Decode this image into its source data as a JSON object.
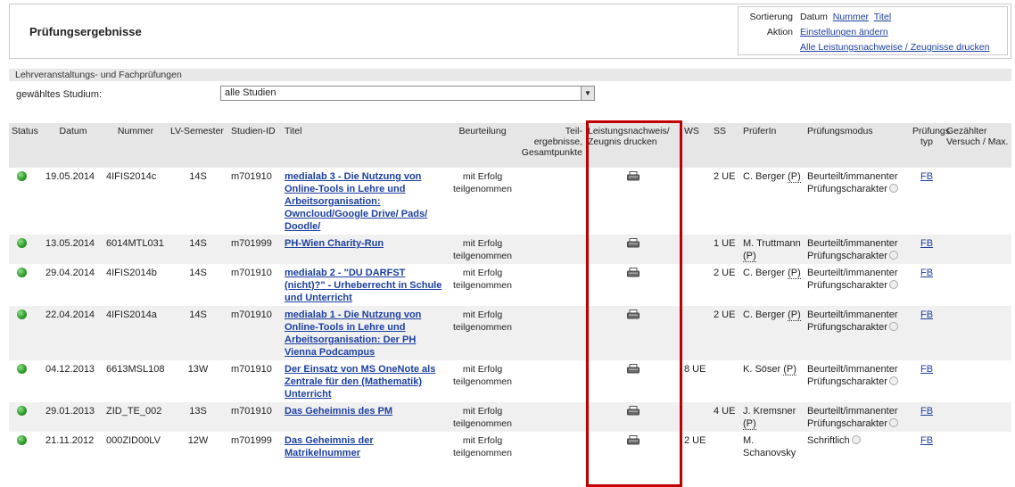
{
  "page": {
    "title": "Prüfungsergebnisse"
  },
  "sort_box": {
    "sort_label": "Sortierung",
    "sort_current": "Datum",
    "sort_number": "Nummer",
    "sort_title": "Titel",
    "action_label": "Aktion",
    "action_settings": "Einstellungen ändern",
    "action_print_all": "Alle Leistungsnachweise / Zeugnisse drucken"
  },
  "section": {
    "heading": "Lehrveranstaltungs- und Fachprüfungen",
    "studium_label": "gewähltes Studium:",
    "studium_value": "alle Studien"
  },
  "table": {
    "headers": {
      "status": "Status",
      "datum": "Datum",
      "nummer": "Nummer",
      "lv_semester": "LV-Semester",
      "studien_id": "Studien-ID",
      "titel": "Titel",
      "beurteilung": "Beurteilung",
      "teil": "Teil-ergebnisse, Gesamtpunkte",
      "leistung": "Leistungsnachweis/ Zeugnis drucken",
      "ws": "WS",
      "ss": "SS",
      "pruefer": "PrüferIn",
      "modus": "Prüfungsmodus",
      "typ": "Prüfungs typ",
      "versuch": "Gezählter Versuch / Max."
    },
    "rows": [
      {
        "datum": "19.05.2014",
        "nummer": "4IFIS2014c",
        "semester": "14S",
        "studien_id": "m701910",
        "titel": "medialab 3 - Die Nutzung von Online-Tools in Lehre und Arbeitsorganisation: Owncloud/Google Drive/ Pads/ Doodle/",
        "beurteilung": "mit Erfolg teilgenommen",
        "ws": "",
        "ss": "2 UE",
        "pruefer": "C. Berger",
        "pruefer_p": "(P)",
        "modus": "Beurteilt/immanenter Prüfungscharakter",
        "typ": "FB"
      },
      {
        "datum": "13.05.2014",
        "nummer": "6014MTL031",
        "semester": "14S",
        "studien_id": "m701999",
        "titel": "PH-Wien Charity-Run",
        "beurteilung": "mit Erfolg teilgenommen",
        "ws": "",
        "ss": "1 UE",
        "pruefer": "M. Truttmann",
        "pruefer_p": "(P)",
        "modus": "Beurteilt/immanenter Prüfungscharakter",
        "typ": "FB"
      },
      {
        "datum": "29.04.2014",
        "nummer": "4IFIS2014b",
        "semester": "14S",
        "studien_id": "m701910",
        "titel": "medialab 2 - \"DU DARFST (nicht)?\" - Urheberrecht in Schule und Unterricht",
        "beurteilung": "mit Erfolg teilgenommen",
        "ws": "",
        "ss": "2 UE",
        "pruefer": "C. Berger",
        "pruefer_p": "(P)",
        "modus": "Beurteilt/immanenter Prüfungscharakter",
        "typ": "FB"
      },
      {
        "datum": "22.04.2014",
        "nummer": "4IFIS2014a",
        "semester": "14S",
        "studien_id": "m701910",
        "titel": "medialab 1 - Die Nutzung von Online-Tools in Lehre und Arbeitsorganisation: Der PH Vienna Podcampus",
        "beurteilung": "mit Erfolg teilgenommen",
        "ws": "",
        "ss": "2 UE",
        "pruefer": "C. Berger",
        "pruefer_p": "(P)",
        "modus": "Beurteilt/immanenter Prüfungscharakter",
        "typ": "FB"
      },
      {
        "datum": "04.12.2013",
        "nummer": "6613MSL108",
        "semester": "13W",
        "studien_id": "m701910",
        "titel": "Der Einsatz von MS OneNote als Zentrale für den (Mathematik) Unterricht",
        "beurteilung": "mit Erfolg teilgenommen",
        "ws": "8 UE",
        "ss": "",
        "pruefer": "K. Söser",
        "pruefer_p": "(P)",
        "modus": "Beurteilt/immanenter Prüfungscharakter",
        "typ": "FB"
      },
      {
        "datum": "29.01.2013",
        "nummer": "ZID_TE_002",
        "semester": "13S",
        "studien_id": "m701910",
        "titel": "Das Geheimnis des PM",
        "beurteilung": "mit Erfolg teilgenommen",
        "ws": "",
        "ss": "4 UE",
        "pruefer": "J. Kremsner",
        "pruefer_p": "(P)",
        "modus": "Beurteilt/immanenter Prüfungscharakter",
        "typ": "FB"
      },
      {
        "datum": "21.11.2012",
        "nummer": "000ZID00LV",
        "semester": "12W",
        "studien_id": "m701999",
        "titel": "Das Geheimnis der Matrikelnummer",
        "beurteilung": "mit Erfolg teilgenommen",
        "ws": "2 UE",
        "ss": "",
        "pruefer": "M. Schanovsky",
        "pruefer_p": "",
        "modus": "Schriftlich",
        "typ": "FB"
      }
    ]
  }
}
